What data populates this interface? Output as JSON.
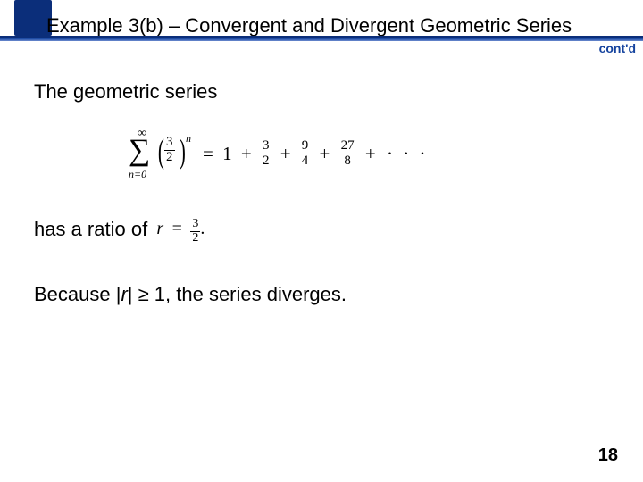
{
  "title": "Example 3(b) – Convergent and Divergent Geometric Series",
  "contd": "cont'd",
  "line1": "The geometric series",
  "series": {
    "sigma_top": "∞",
    "sigma_bottom": "n=0",
    "base_num": "3",
    "base_den": "2",
    "exponent": "n",
    "eq": "=",
    "t1": "1",
    "plus": "+",
    "f2n": "3",
    "f2d": "2",
    "f3n": "9",
    "f3d": "4",
    "f4n": "27",
    "f4d": "8",
    "dots": "· · ·"
  },
  "line2_prefix": "has a ratio of",
  "ratio": {
    "r": "r",
    "eq": "=",
    "num": "3",
    "den": "2",
    "period": "."
  },
  "line3_a": "Because |",
  "line3_r": "r",
  "line3_b": "| ≥ 1, the series diverges.",
  "page": "18"
}
